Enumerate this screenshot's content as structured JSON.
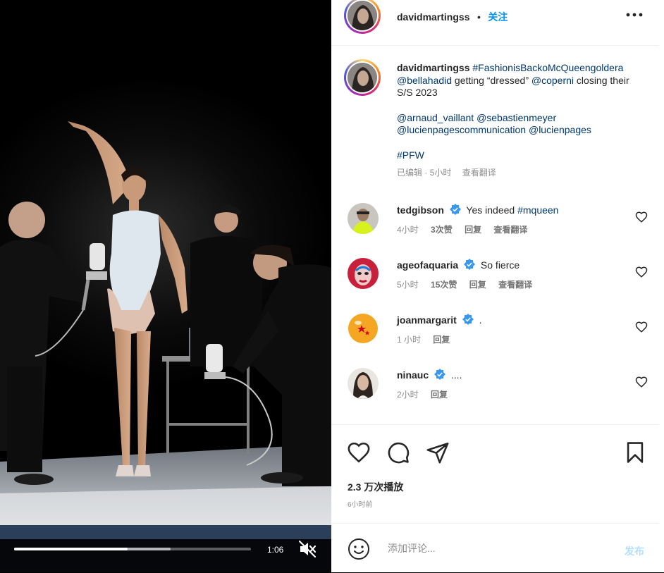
{
  "video": {
    "progress": 0.48,
    "time": "1:06",
    "mute_icon": "muted-speaker-icon"
  },
  "post": {
    "username": "davidmartingss",
    "dot": "•",
    "follow_label": "关注",
    "more_icon": "more-horizontal-icon"
  },
  "caption": {
    "username": "davidmartingss",
    "hashtag": "#FashionisBackoMcQueengoldera",
    "mention_bella": "@bellahadid",
    "text_getting": " getting “dressed” ",
    "mention_coperni": "@coperni",
    "text_closing": " closing their S/S 2023",
    "mention_arnaud": "@arnaud_vaillant",
    "mention_sebastien": "@sebastienmeyer",
    "mention_lucien_comm": "@lucienpagescommunication",
    "mention_lucien": "@lucienpages",
    "hashtag_pfw": "#PFW",
    "edited": "已编辑",
    "sep": " · ",
    "age": "5小时",
    "translate": "查看翻译"
  },
  "comments": [
    {
      "username": "tedgibson",
      "text": "Yes indeed ",
      "tag": "#mqueen",
      "age": "4小时",
      "likes": "3次赞",
      "reply": "回复",
      "translate": "查看翻译"
    },
    {
      "username": "ageofaquaria",
      "text": "So fierce",
      "tag": "",
      "age": "5小时",
      "likes": "15次赞",
      "reply": "回复",
      "translate": "查看翻译"
    },
    {
      "username": "joanmargarit",
      "text": ".",
      "tag": "",
      "age": "1 小时",
      "likes": "",
      "reply": "回复",
      "translate": ""
    },
    {
      "username": "ninauc",
      "text": "....",
      "tag": "",
      "age": "2小时",
      "likes": "",
      "reply": "回复",
      "translate": ""
    }
  ],
  "actions": {
    "plays": "2.3 万次播放",
    "posted": "6小时前"
  },
  "composer": {
    "placeholder": "添加评论...",
    "post_label": "发布"
  },
  "colors": {
    "accent": "#0095f6",
    "link": "#00376b",
    "muted": "#8e8e8e",
    "post_disabled": "#b2dffc",
    "verified": "#3897f0"
  }
}
